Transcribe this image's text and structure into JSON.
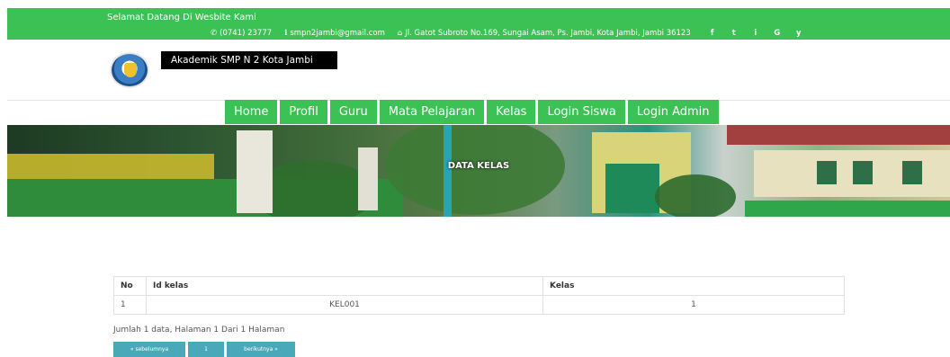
{
  "topbar": {
    "welcome": "Selamat Datang Di Wesbite Kami",
    "phone": "(0741) 23777",
    "email": "smpn2jambi@gmail.com",
    "address": "Jl. Gatot Subroto No.169, Sungai Asam, Ps. Jambi, Kota Jambi, Jambi 36123",
    "social": [
      "f",
      "t",
      "i",
      "G",
      "y"
    ],
    "social_icons": [
      "facebook-icon",
      "twitter-icon",
      "instagram-icon",
      "google-icon",
      "youtube-icon"
    ]
  },
  "header": {
    "brand": "Akademik SMP N 2 Kota Jambi"
  },
  "nav": {
    "items": [
      "Home",
      "Profil",
      "Guru",
      "Mata Pelajaran",
      "Kelas",
      "Login Siswa",
      "Login Admin"
    ]
  },
  "banner": {
    "title": "DATA KELAS"
  },
  "table": {
    "headers": [
      "No",
      "Id kelas",
      "Kelas"
    ],
    "rows": [
      [
        "1",
        "KEL001",
        "1"
      ]
    ]
  },
  "summary": "Jumlah 1 data, Halaman 1 Dari 1 Halaman",
  "pagination": {
    "prev": "« sebelumnya",
    "page": "1",
    "next": "berikutnya »"
  },
  "colors": {
    "accent_green": "#3cc154",
    "pager_teal": "#4aa9b8",
    "brand_bg": "#000000"
  }
}
